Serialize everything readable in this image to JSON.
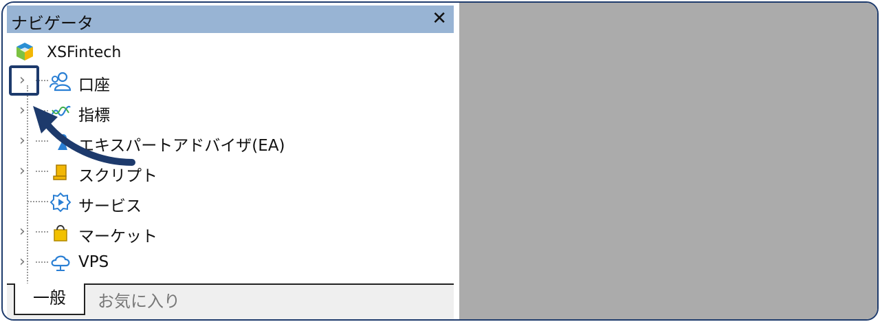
{
  "window": {
    "title": "ナビゲータ",
    "close_glyph": "✕"
  },
  "tree": {
    "root": {
      "label": "XSFintech",
      "icon": "xsfintech-logo-icon"
    },
    "items": [
      {
        "label": "口座",
        "icon": "account-icon",
        "expandable": true
      },
      {
        "label": "指標",
        "icon": "indicator-icon",
        "expandable": true
      },
      {
        "label": "エキスパートアドバイザ(EA)",
        "icon": "expert-advisor-icon",
        "expandable": true
      },
      {
        "label": "スクリプト",
        "icon": "script-icon",
        "expandable": true
      },
      {
        "label": "サービス",
        "icon": "service-icon",
        "expandable": false
      },
      {
        "label": "マーケット",
        "icon": "market-icon",
        "expandable": true
      },
      {
        "label": "VPS",
        "icon": "vps-icon",
        "expandable": true
      }
    ],
    "expander_glyph": "›"
  },
  "tabs": [
    {
      "label": "一般",
      "active": true
    },
    {
      "label": "お気に入り",
      "active": false
    }
  ],
  "colors": {
    "title_bar": "#98b4d4",
    "annotation": "#1d3a6c",
    "right_pane": "#ababab"
  }
}
